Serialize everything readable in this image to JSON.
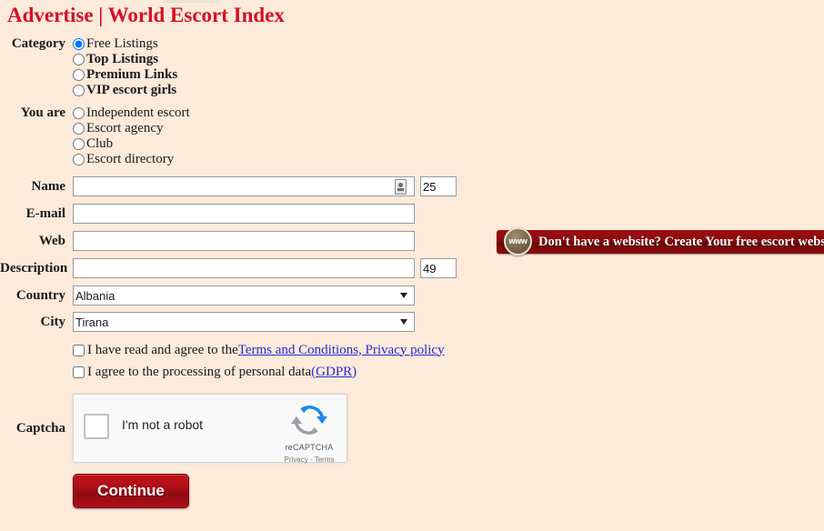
{
  "page": {
    "title": "Advertise | World Escort Index"
  },
  "form": {
    "category": {
      "label": "Category",
      "options": [
        {
          "label": "Free Listings",
          "bold": false,
          "selected": true
        },
        {
          "label": "Top Listings",
          "bold": true,
          "selected": false
        },
        {
          "label": "Premium Links",
          "bold": true,
          "selected": false
        },
        {
          "label": "VIP escort girls",
          "bold": true,
          "selected": false
        }
      ]
    },
    "you_are": {
      "label": "You are",
      "options": [
        {
          "label": "Independent escort",
          "selected": false
        },
        {
          "label": "Escort agency",
          "selected": false
        },
        {
          "label": "Club",
          "selected": false
        },
        {
          "label": "Escort directory",
          "selected": false
        }
      ]
    },
    "name": {
      "label": "Name",
      "value": "",
      "placeholder": "",
      "counter": "25",
      "icon": "autofill-spinner-icon"
    },
    "email": {
      "label": "E-mail",
      "value": "",
      "placeholder": ""
    },
    "web": {
      "label": "Web",
      "value": "",
      "placeholder": ""
    },
    "description": {
      "label": "Description",
      "value": "",
      "placeholder": "",
      "counter": "49"
    },
    "country": {
      "label": "Country",
      "value": "Albania"
    },
    "city": {
      "label": "City",
      "value": "Tirana"
    },
    "terms": {
      "text": "I have read and agree to the",
      "link": "Terms and Conditions, Privacy policy",
      "checked": false
    },
    "gdpr": {
      "text": "I agree to the processing of personal data",
      "link": "(GDPR)",
      "checked": false
    },
    "captcha": {
      "label": "Captcha",
      "checkbox_label": "I'm not a robot",
      "brand": "reCAPTCHA",
      "terms": "Privacy - Terms",
      "checked": false
    },
    "submit": {
      "label": "Continue"
    }
  },
  "banner": {
    "badge_text": "www",
    "text": "Don't have a website? Create Your free escort website here"
  },
  "colors": {
    "background": "#fceadb",
    "title": "#d31226",
    "banner": "#8a0c0d",
    "button": "#ad0f16",
    "link": "#2a2ad0"
  }
}
